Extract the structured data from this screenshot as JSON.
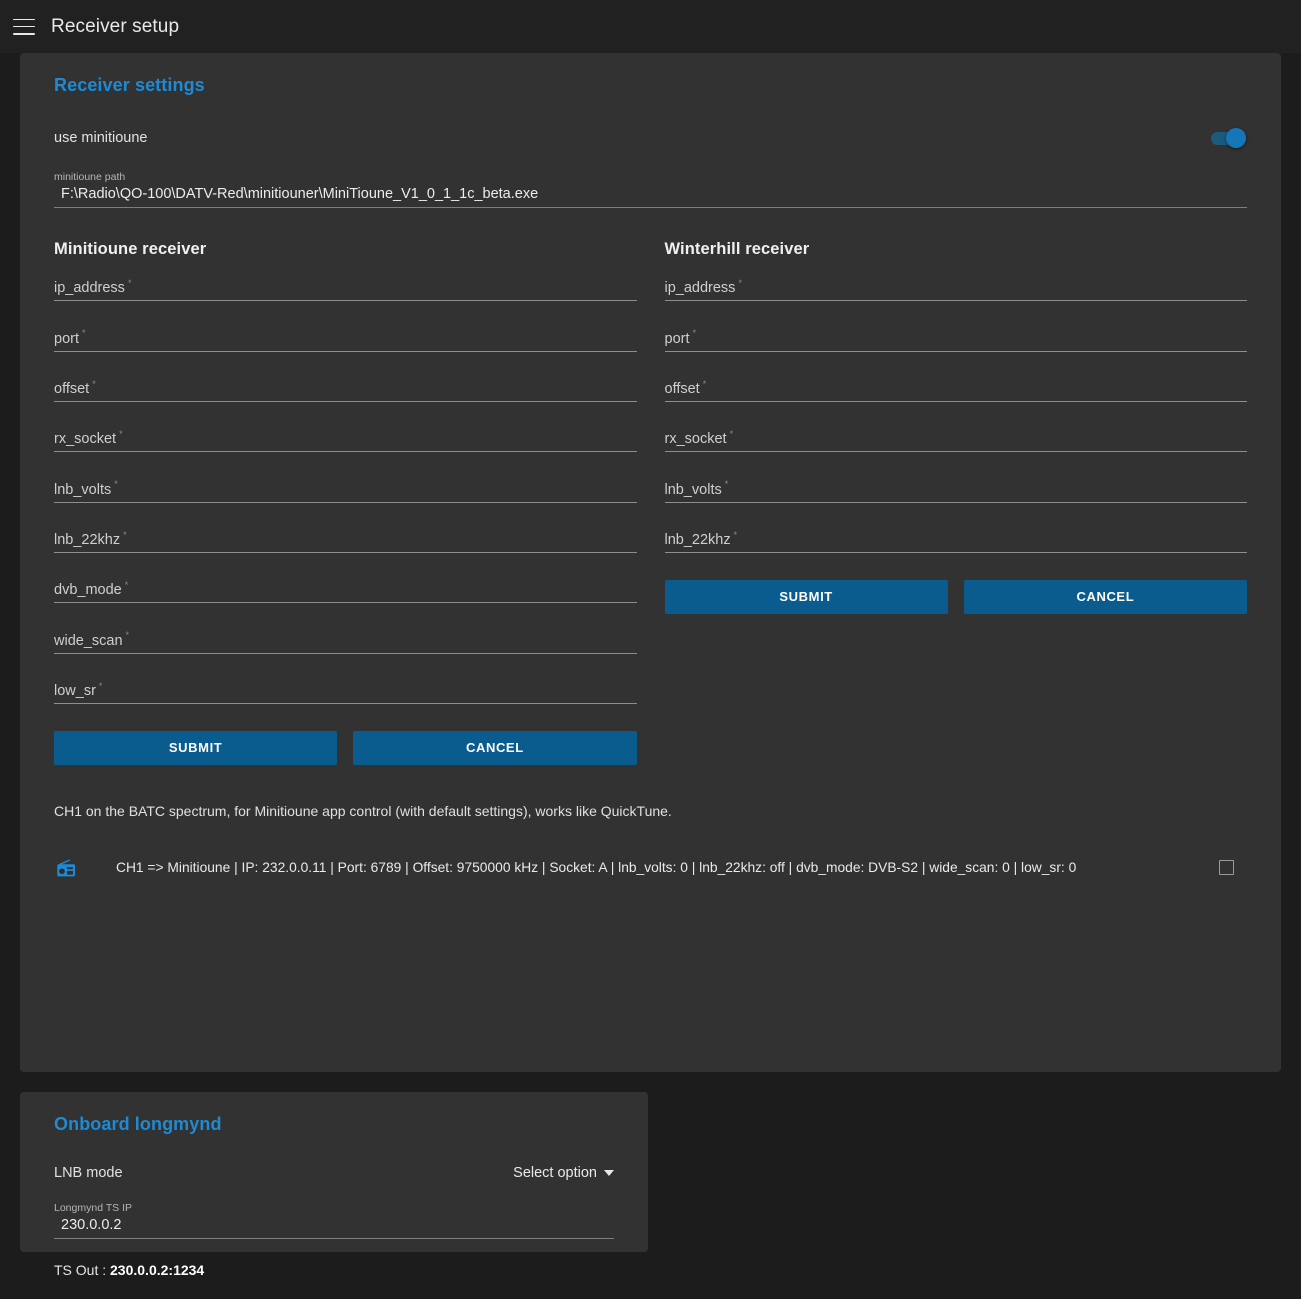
{
  "appbar": {
    "menu_icon": "hamburger-menu-icon",
    "title": "Receiver setup"
  },
  "receiver_settings": {
    "title": "Receiver settings",
    "use_minitioune": {
      "label": "use minitioune",
      "enabled": true
    },
    "minitioune_path": {
      "label": "minitioune path",
      "value": "F:\\Radio\\QO-100\\DATV-Red\\minitiouner\\MiniTioune_V1_0_1_1c_beta.exe"
    },
    "minitioune_receiver": {
      "heading": "Minitioune receiver",
      "fields": [
        {
          "label": "ip_address",
          "value": "",
          "required": "*"
        },
        {
          "label": "port",
          "value": "",
          "required": "*"
        },
        {
          "label": "offset",
          "value": "",
          "required": "*"
        },
        {
          "label": "rx_socket",
          "value": "",
          "required": "*"
        },
        {
          "label": "lnb_volts",
          "value": "",
          "required": "*"
        },
        {
          "label": "lnb_22khz",
          "value": "",
          "required": "*"
        },
        {
          "label": "dvb_mode",
          "value": "",
          "required": "*"
        },
        {
          "label": "wide_scan",
          "value": "",
          "required": "*"
        },
        {
          "label": "low_sr",
          "value": "",
          "required": "*"
        }
      ],
      "submit_label": "SUBMIT",
      "cancel_label": "CANCEL"
    },
    "winterhill_receiver": {
      "heading": "Winterhill receiver",
      "fields": [
        {
          "label": "ip_address",
          "value": "",
          "required": "*"
        },
        {
          "label": "port",
          "value": "",
          "required": "*"
        },
        {
          "label": "offset",
          "value": "",
          "required": "*"
        },
        {
          "label": "rx_socket",
          "value": "",
          "required": "*"
        },
        {
          "label": "lnb_volts",
          "value": "",
          "required": "*"
        },
        {
          "label": "lnb_22khz",
          "value": "",
          "required": "*"
        }
      ],
      "submit_label": "SUBMIT",
      "cancel_label": "CANCEL"
    },
    "note": "CH1 on the BATC spectrum, for Minitioune app control (with default settings), works like QuickTune.",
    "channel_row": {
      "icon": "radio-icon",
      "text": "CH1 => Minitioune | IP: 232.0.0.11 | Port: 6789 | Offset: 9750000 kHz | Socket: A | lnb_volts: 0 | lnb_22khz: off | dvb_mode: DVB-S2 | wide_scan: 0 | low_sr: 0",
      "checked": false
    }
  },
  "onboard_longmynd": {
    "title": "Onboard longmynd",
    "lnb_mode": {
      "label": "LNB mode",
      "selected": "Select option"
    },
    "ts_ip": {
      "label": "Longmynd TS IP",
      "value": "230.0.0.2"
    },
    "ts_out": {
      "label": "TS Out : ",
      "value": "230.0.0.2:1234"
    }
  },
  "colors": {
    "accent_blue": "#1f8ad4",
    "button_blue": "#0a5c8f",
    "panel": "#323232",
    "background": "#1c1c1c",
    "appbar": "#212121"
  }
}
